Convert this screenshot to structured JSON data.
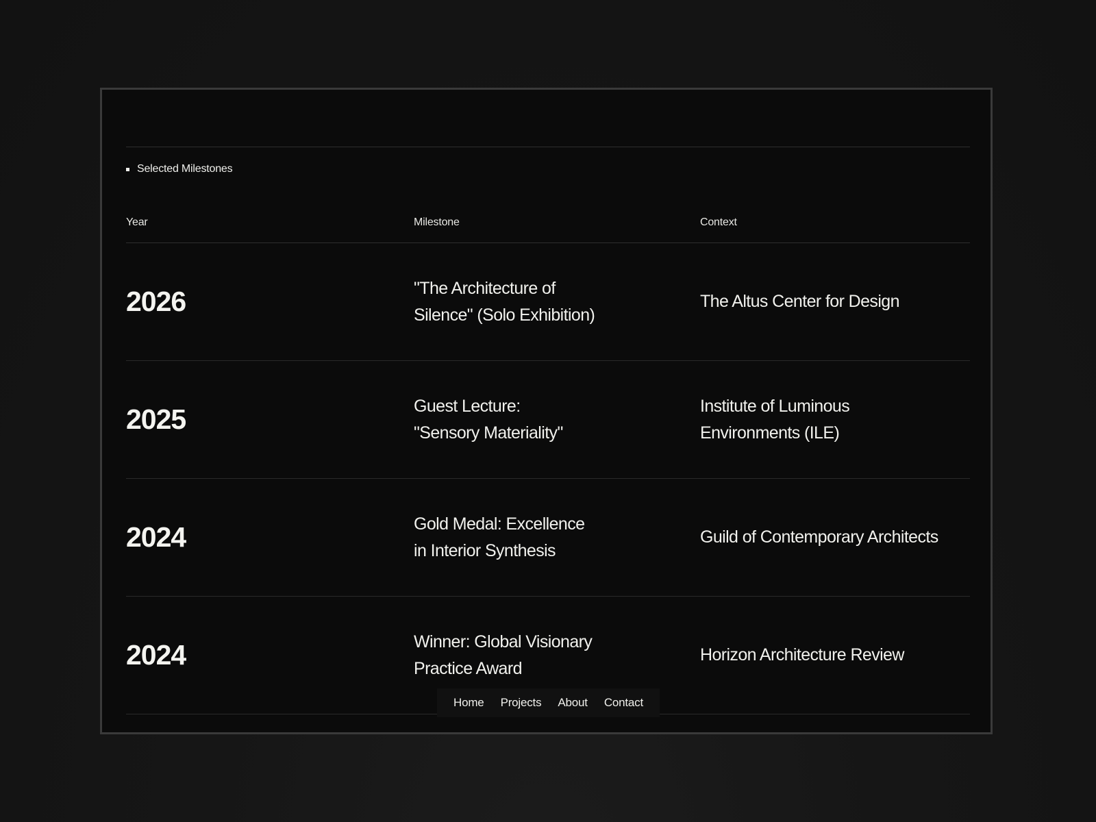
{
  "section": {
    "label": "Selected Milestones"
  },
  "table": {
    "headers": {
      "year": "Year",
      "milestone": "Milestone",
      "context": "Context"
    },
    "rows": [
      {
        "year": "2026",
        "milestone_line1": "\"The Architecture of",
        "milestone_line2": "Silence\" (Solo Exhibition)",
        "context_line1": "The Altus Center for Design",
        "context_line2": ""
      },
      {
        "year": "2025",
        "milestone_line1": "Guest Lecture:",
        "milestone_line2": "\"Sensory Materiality\"",
        "context_line1": "Institute of Luminous",
        "context_line2": "Environments (ILE)"
      },
      {
        "year": "2024",
        "milestone_line1": "Gold Medal: Excellence",
        "milestone_line2": "in Interior Synthesis",
        "context_line1": "Guild of Contemporary Architects",
        "context_line2": ""
      },
      {
        "year": "2024",
        "milestone_line1": "Winner: Global Visionary",
        "milestone_line2": "Practice Award",
        "context_line1": "Horizon Architecture Review",
        "context_line2": ""
      }
    ]
  },
  "nav": {
    "items": [
      "Home",
      "Projects",
      "About",
      "Contact"
    ]
  },
  "colors": {
    "page_background": "#141414",
    "panel_background": "#0b0b0b",
    "panel_border": "#3a3a3a",
    "text": "#f2f2ee",
    "rule": "#2e2e2e"
  }
}
